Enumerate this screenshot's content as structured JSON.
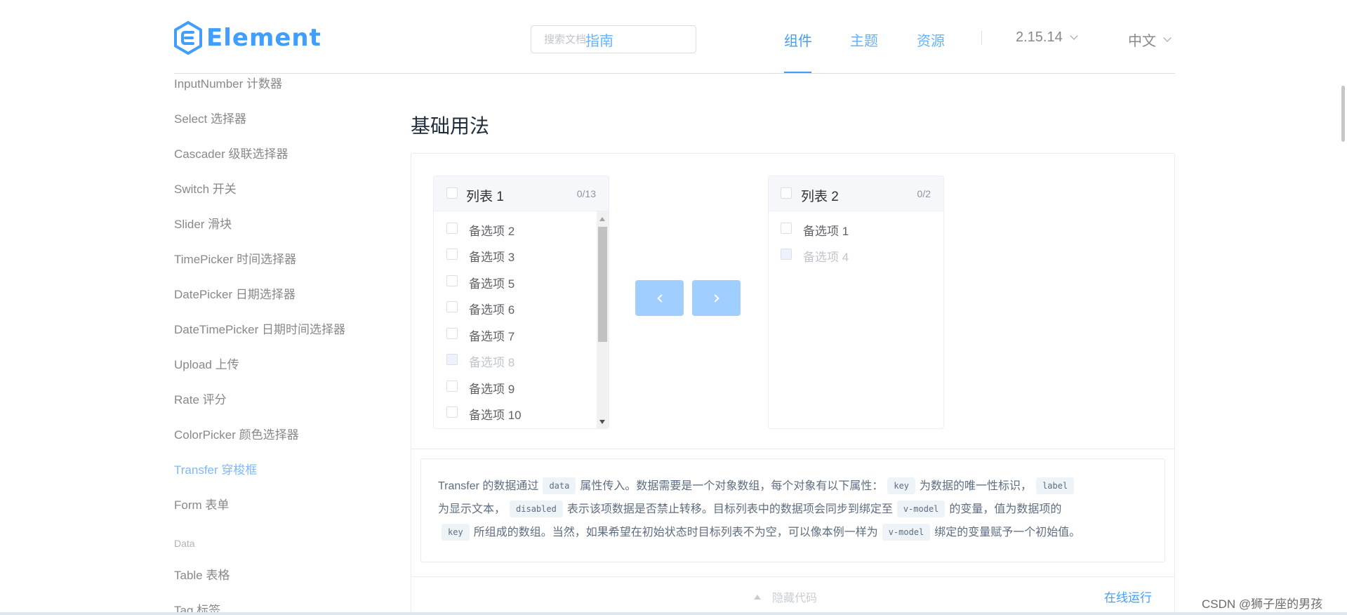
{
  "brand": {
    "name": "Element",
    "color": "#409eff"
  },
  "search": {
    "placeholder": "搜索文档"
  },
  "nav": {
    "items": [
      "指南",
      "组件",
      "主题",
      "资源"
    ],
    "active": "组件",
    "version": "2.15.14",
    "language": "中文"
  },
  "sidebar": {
    "items": [
      "InputNumber 计数器",
      "Select 选择器",
      "Cascader 级联选择器",
      "Switch 开关",
      "Slider 滑块",
      "TimePicker 时间选择器",
      "DatePicker 日期选择器",
      "DateTimePicker 日期时间选择器",
      "Upload 上传",
      "Rate 评分",
      "ColorPicker 颜色选择器",
      "Transfer 穿梭框",
      "Form 表单"
    ],
    "active": "Transfer 穿梭框",
    "group_data": "Data",
    "data_items": [
      "Table 表格",
      "Tag 标签"
    ]
  },
  "section": {
    "title": "基础用法"
  },
  "transfer": {
    "left": {
      "title": "列表 1",
      "count": "0/13",
      "items": [
        {
          "label": "备选项 2",
          "disabled": false
        },
        {
          "label": "备选项 3",
          "disabled": false
        },
        {
          "label": "备选项 5",
          "disabled": false
        },
        {
          "label": "备选项 6",
          "disabled": false
        },
        {
          "label": "备选项 7",
          "disabled": false
        },
        {
          "label": "备选项 8",
          "disabled": true
        },
        {
          "label": "备选项 9",
          "disabled": false
        },
        {
          "label": "备选项 10",
          "disabled": false
        }
      ]
    },
    "right": {
      "title": "列表 2",
      "count": "0/2",
      "items": [
        {
          "label": "备选项 1",
          "disabled": false
        },
        {
          "label": "备选项 4",
          "disabled": true
        }
      ]
    },
    "button_color": "#a0cfff"
  },
  "description": {
    "t1": "Transfer 的数据通过",
    "c1": "data",
    "t2": "属性传入。数据需要是一个对象数组，每个对象有以下属性：",
    "c2": "key",
    "t3": "为数据的唯一性标识，",
    "c3": "label",
    "t4": "为显示文本，",
    "c4": "disabled",
    "t5": "表示该项数据是否禁止转移。目标列表中的数据项会同步到绑定至",
    "c5": "v-model",
    "t6": "的变量，值为数据项的",
    "c6": "key",
    "t7": "所组成的数组。当然，如果希望在初始状态时目标列表不为空，可以像本例一样为",
    "c7": "v-model",
    "t8": "绑定的变量赋予一个初始值。"
  },
  "footer": {
    "hide_code": "隐藏代码",
    "run_online": "在线运行"
  },
  "watermark": "CSDN @狮子座的男孩"
}
